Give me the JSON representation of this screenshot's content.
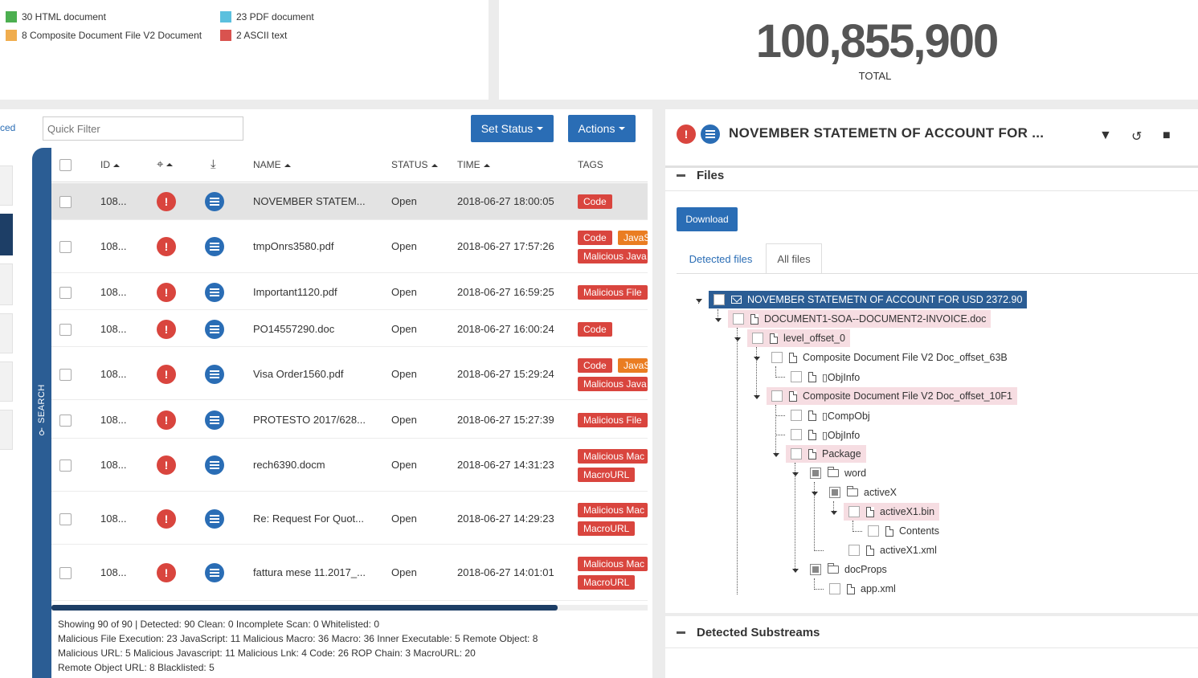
{
  "legend": [
    {
      "label": "30 HTML document",
      "color": "#4caf50"
    },
    {
      "label": "23 PDF document",
      "color": "#5bc0de"
    },
    {
      "label": "8 Composite Document File V2 Document",
      "color": "#f0ad4e"
    },
    {
      "label": "2 ASCII text",
      "color": "#d9534f"
    }
  ],
  "total": {
    "value": "100,855,900",
    "label": "TOTAL"
  },
  "list": {
    "advanced_link": "ced",
    "search_label": "SEARCH",
    "quick_filter_placeholder": "Quick Filter",
    "set_status_label": "Set Status",
    "actions_label": "Actions",
    "columns": {
      "id": "ID",
      "name": "NAME",
      "status": "STATUS",
      "time": "TIME",
      "tags": "TAGS"
    },
    "rows": [
      {
        "id": "108...",
        "name": "NOVEMBER STATEM...",
        "status": "Open",
        "time": "2018-06-27 18:00:05",
        "tags": [
          "Code"
        ]
      },
      {
        "id": "108...",
        "name": "tmpOnrs3580.pdf",
        "status": "Open",
        "time": "2018-06-27 17:57:26",
        "tags": [
          "Code",
          "JavaS",
          "Malicious Java"
        ]
      },
      {
        "id": "108...",
        "name": "Important1120.pdf",
        "status": "Open",
        "time": "2018-06-27 16:59:25",
        "tags": [
          "Malicious File"
        ]
      },
      {
        "id": "108...",
        "name": "PO14557290.doc",
        "status": "Open",
        "time": "2018-06-27 16:00:24",
        "tags": [
          "Code"
        ]
      },
      {
        "id": "108...",
        "name": "Visa Order1560.pdf",
        "status": "Open",
        "time": "2018-06-27 15:29:24",
        "tags": [
          "Code",
          "JavaS",
          "Malicious Java"
        ]
      },
      {
        "id": "108...",
        "name": "PROTESTO 2017/628...",
        "status": "Open",
        "time": "2018-06-27 15:27:39",
        "tags": [
          "Malicious File"
        ]
      },
      {
        "id": "108...",
        "name": "rech6390.docm",
        "status": "Open",
        "time": "2018-06-27 14:31:23",
        "tags": [
          "Malicious Mac",
          "MacroURL"
        ]
      },
      {
        "id": "108...",
        "name": "Re: Request For Quot...",
        "status": "Open",
        "time": "2018-06-27 14:29:23",
        "tags": [
          "Malicious Mac",
          "MacroURL"
        ]
      },
      {
        "id": "108...",
        "name": "fattura mese 11.2017_...",
        "status": "Open",
        "time": "2018-06-27 14:01:01",
        "tags": [
          "Malicious Mac",
          "MacroURL"
        ]
      }
    ],
    "stats": [
      "Showing 90 of 90 |  Detected: 90  Clean: 0  Incomplete Scan: 0  Whitelisted: 0",
      "Malicious File Execution: 23  JavaScript: 11  Malicious Macro: 36  Macro: 36  Inner Executable: 5  Remote Object: 8",
      "Malicious URL: 5  Malicious Javascript: 11  Malicious Lnk: 4  Code: 26  ROP Chain: 3  MacroURL: 20",
      "Remote Object URL: 8  Blacklisted: 5"
    ]
  },
  "detail": {
    "title": "NOVEMBER STATEMETN OF ACCOUNT FOR ...",
    "files_heading": "Files",
    "download_label": "Download",
    "tabs": [
      "Detected files",
      "All files"
    ],
    "substreams_heading": "Detected Substreams",
    "tree": [
      "NOVEMBER STATEMETN OF ACCOUNT FOR USD 2372.90",
      "DOCUMENT1-SOA--DOCUMENT2-INVOICE.doc",
      "level_offset_0",
      "Composite Document File V2 Doc_offset_63B",
      "▯ObjInfo",
      "Composite Document File V2 Doc_offset_10F1",
      "▯CompObj",
      "▯ObjInfo",
      "Package",
      "word",
      "activeX",
      "activeX1.bin",
      "Contents",
      "activeX1.xml",
      "docProps",
      "app.xml"
    ]
  }
}
